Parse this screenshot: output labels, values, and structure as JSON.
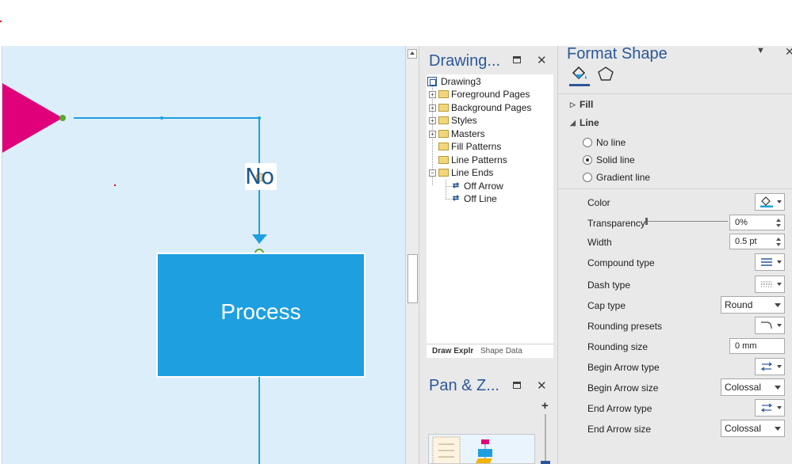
{
  "colors": {
    "canvas_bg": "#dceefa",
    "process_fill": "#1e9fe0",
    "connector": "#1e9fe0",
    "triangle": "#e0007a",
    "accent": "#2b579a"
  },
  "canvas": {
    "no_label": "No",
    "process_label": "Process"
  },
  "drawing_explorer": {
    "title": "Drawing...",
    "tree": [
      {
        "label": "Drawing3",
        "level": 0,
        "icon": "document-icon"
      },
      {
        "label": "Foreground Pages",
        "level": 1,
        "icon": "folder-icon",
        "expandable": true
      },
      {
        "label": "Background Pages",
        "level": 1,
        "icon": "folder-icon",
        "expandable": true
      },
      {
        "label": "Styles",
        "level": 1,
        "icon": "folder-icon",
        "expandable": true
      },
      {
        "label": "Masters",
        "level": 1,
        "icon": "folder-icon",
        "expandable": true
      },
      {
        "label": "Fill Patterns",
        "level": 1,
        "icon": "folder-icon",
        "expandable": false
      },
      {
        "label": "Line Patterns",
        "level": 1,
        "icon": "folder-icon",
        "expandable": false
      },
      {
        "label": "Line Ends",
        "level": 1,
        "icon": "folder-icon",
        "expandable": true,
        "expanded": true
      },
      {
        "label": "Off Arrow",
        "level": 2,
        "icon": "line-end-icon"
      },
      {
        "label": "Off Line",
        "level": 2,
        "icon": "line-end-icon"
      }
    ],
    "tabs": [
      "Draw Explr",
      "Shape Data"
    ]
  },
  "pan_zoom": {
    "title": "Pan & Z...",
    "zoom_plus": "+"
  },
  "format_shape": {
    "title": "Format Shape",
    "sections": {
      "fill": "Fill",
      "line": "Line"
    },
    "line_options": [
      {
        "label": "No line",
        "selected": false
      },
      {
        "label": "Solid line",
        "selected": true
      },
      {
        "label": "Gradient line",
        "selected": false
      }
    ],
    "properties": {
      "color": "Color",
      "transparency": "Transparency",
      "transparency_value": "0%",
      "width": "Width",
      "width_value": "0.5 pt",
      "compound_type": "Compound type",
      "dash_type": "Dash type",
      "cap_type": "Cap type",
      "cap_type_value": "Round",
      "rounding_presets": "Rounding presets",
      "rounding_size": "Rounding size",
      "rounding_size_value": "0 mm",
      "begin_arrow_type": "Begin Arrow type",
      "begin_arrow_size": "Begin Arrow size",
      "begin_arrow_size_value": "Colossal",
      "end_arrow_type": "End Arrow type",
      "end_arrow_size": "End Arrow size",
      "end_arrow_size_value": "Colossal"
    }
  }
}
